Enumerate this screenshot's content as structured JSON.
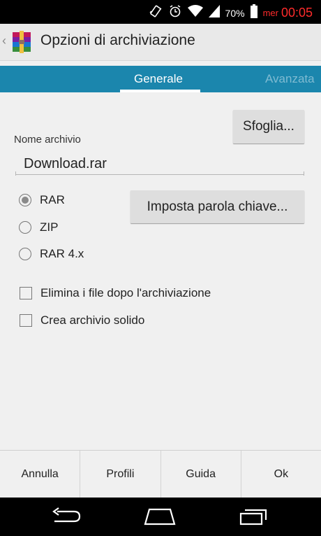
{
  "status_bar": {
    "battery_percent": "70%",
    "day": "mer",
    "time": "00:05",
    "icons": [
      "vibrate-icon",
      "alarm-icon",
      "wifi-icon",
      "signal-icon",
      "battery-icon"
    ],
    "time_color": "#ff2b2b"
  },
  "action_bar": {
    "title": "Opzioni di archiviazione",
    "icons": [
      "back-icon",
      "winrar-logo-icon"
    ]
  },
  "tabs": [
    {
      "label": "Generale",
      "active": true
    },
    {
      "label": "Avanzata",
      "active": false
    }
  ],
  "accent_color": "#1b86ad",
  "archive_name": {
    "label": "Nome archivio",
    "value": "Download.rar"
  },
  "browse_button": "Sfoglia...",
  "password_button": "Imposta parola chiave...",
  "formats": [
    {
      "label": "RAR",
      "selected": true
    },
    {
      "label": "ZIP",
      "selected": false
    },
    {
      "label": "RAR 4.x",
      "selected": false
    }
  ],
  "options": [
    {
      "label": "Elimina i file dopo l'archiviazione",
      "checked": false
    },
    {
      "label": "Crea archivio solido",
      "checked": false
    }
  ],
  "bottom_buttons": [
    "Annulla",
    "Profili",
    "Guida",
    "Ok"
  ],
  "nav_bar": {
    "icons": [
      "back-nav-icon",
      "home-nav-icon",
      "recents-nav-icon"
    ]
  }
}
